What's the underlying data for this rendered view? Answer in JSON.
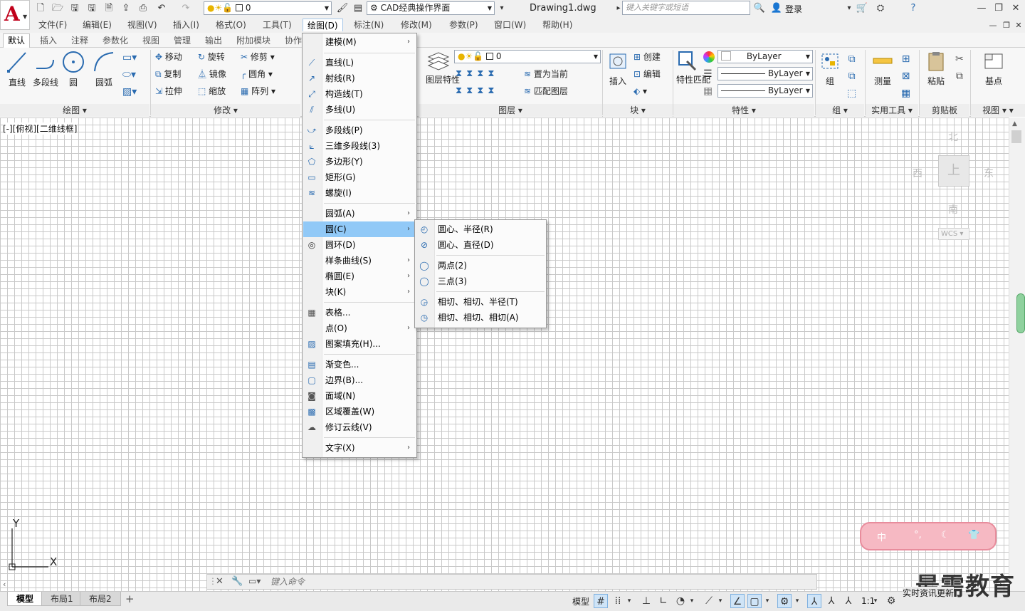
{
  "title_bar": {
    "workspace": "CAD经典操作界面",
    "layer_value": "0",
    "document": "Drawing1.dwg",
    "search_placeholder": "键入关键字或短语",
    "login": "登录"
  },
  "menubar": [
    "文件(F)",
    "编辑(E)",
    "视图(V)",
    "插入(I)",
    "格式(O)",
    "工具(T)",
    "绘图(D)",
    "标注(N)",
    "修改(M)",
    "参数(P)",
    "窗口(W)",
    "帮助(H)"
  ],
  "ribbon_tabs": [
    "默认",
    "插入",
    "注释",
    "参数化",
    "视图",
    "管理",
    "输出",
    "附加模块",
    "协作"
  ],
  "ribbon": {
    "draw": {
      "title": "绘图",
      "line": "直线",
      "polyline": "多段线",
      "circle": "圆",
      "arc": "圆弧"
    },
    "modify": {
      "title": "修改",
      "move": "移动",
      "rotate": "旋转",
      "trim": "修剪",
      "copy": "复制",
      "mirror": "镜像",
      "fillet": "圆角",
      "stretch": "拉伸",
      "scale": "缩放",
      "array": "阵列"
    },
    "layers": {
      "title": "图层",
      "layer_props": "图层特性",
      "current": "0",
      "set_current": "置为当前",
      "match_layer": "匹配图层"
    },
    "block": {
      "title": "块",
      "insert": "插入",
      "create": "创建",
      "edit": "编辑"
    },
    "properties": {
      "title": "特性",
      "match": "特性匹配",
      "color": "ByLayer",
      "linetype": "ByLayer",
      "lineweight": "ByLayer"
    },
    "groups": {
      "title": "组",
      "group": "组"
    },
    "utilities": {
      "title": "实用工具",
      "measure": "测量"
    },
    "clipboard": {
      "title": "剪贴板",
      "paste": "粘贴"
    },
    "view": {
      "title": "视图",
      "base": "基点"
    }
  },
  "viewport_label": "[-][俯视][二维线框]",
  "viewcube": {
    "north": "北",
    "south": "南",
    "east": "东",
    "west": "西",
    "top": "上",
    "wcs": "WCS"
  },
  "draw_menu": {
    "items": [
      {
        "label": "建模(M)",
        "sub": true
      },
      {
        "label": "直线(L)"
      },
      {
        "label": "射线(R)"
      },
      {
        "label": "构造线(T)"
      },
      {
        "label": "多线(U)"
      },
      {
        "label": "多段线(P)"
      },
      {
        "label": "三维多段线(3)"
      },
      {
        "label": "多边形(Y)"
      },
      {
        "label": "矩形(G)"
      },
      {
        "label": "螺旋(I)"
      },
      {
        "label": "圆弧(A)",
        "sub": true
      },
      {
        "label": "圆(C)",
        "sub": true
      },
      {
        "label": "圆环(D)"
      },
      {
        "label": "样条曲线(S)",
        "sub": true
      },
      {
        "label": "椭圆(E)",
        "sub": true
      },
      {
        "label": "块(K)",
        "sub": true
      },
      {
        "label": "表格..."
      },
      {
        "label": "点(O)",
        "sub": true
      },
      {
        "label": "图案填充(H)..."
      },
      {
        "label": "渐变色..."
      },
      {
        "label": "边界(B)..."
      },
      {
        "label": "面域(N)"
      },
      {
        "label": "区域覆盖(W)"
      },
      {
        "label": "修订云线(V)"
      },
      {
        "label": "文字(X)",
        "sub": true
      }
    ]
  },
  "circle_submenu": {
    "items": [
      "圆心、半径(R)",
      "圆心、直径(D)",
      "两点(2)",
      "三点(3)",
      "相切、相切、半径(T)",
      "相切、相切、相切(A)"
    ]
  },
  "command_line": {
    "placeholder": "键入命令"
  },
  "layout_tabs": [
    "模型",
    "布局1",
    "布局2"
  ],
  "status": {
    "model": "模型",
    "scale": "1:1"
  },
  "ucs": {
    "x": "X",
    "y": "Y"
  },
  "watermark": "最需教育",
  "news": "实时资讯更新",
  "ime": {
    "label": "中"
  }
}
